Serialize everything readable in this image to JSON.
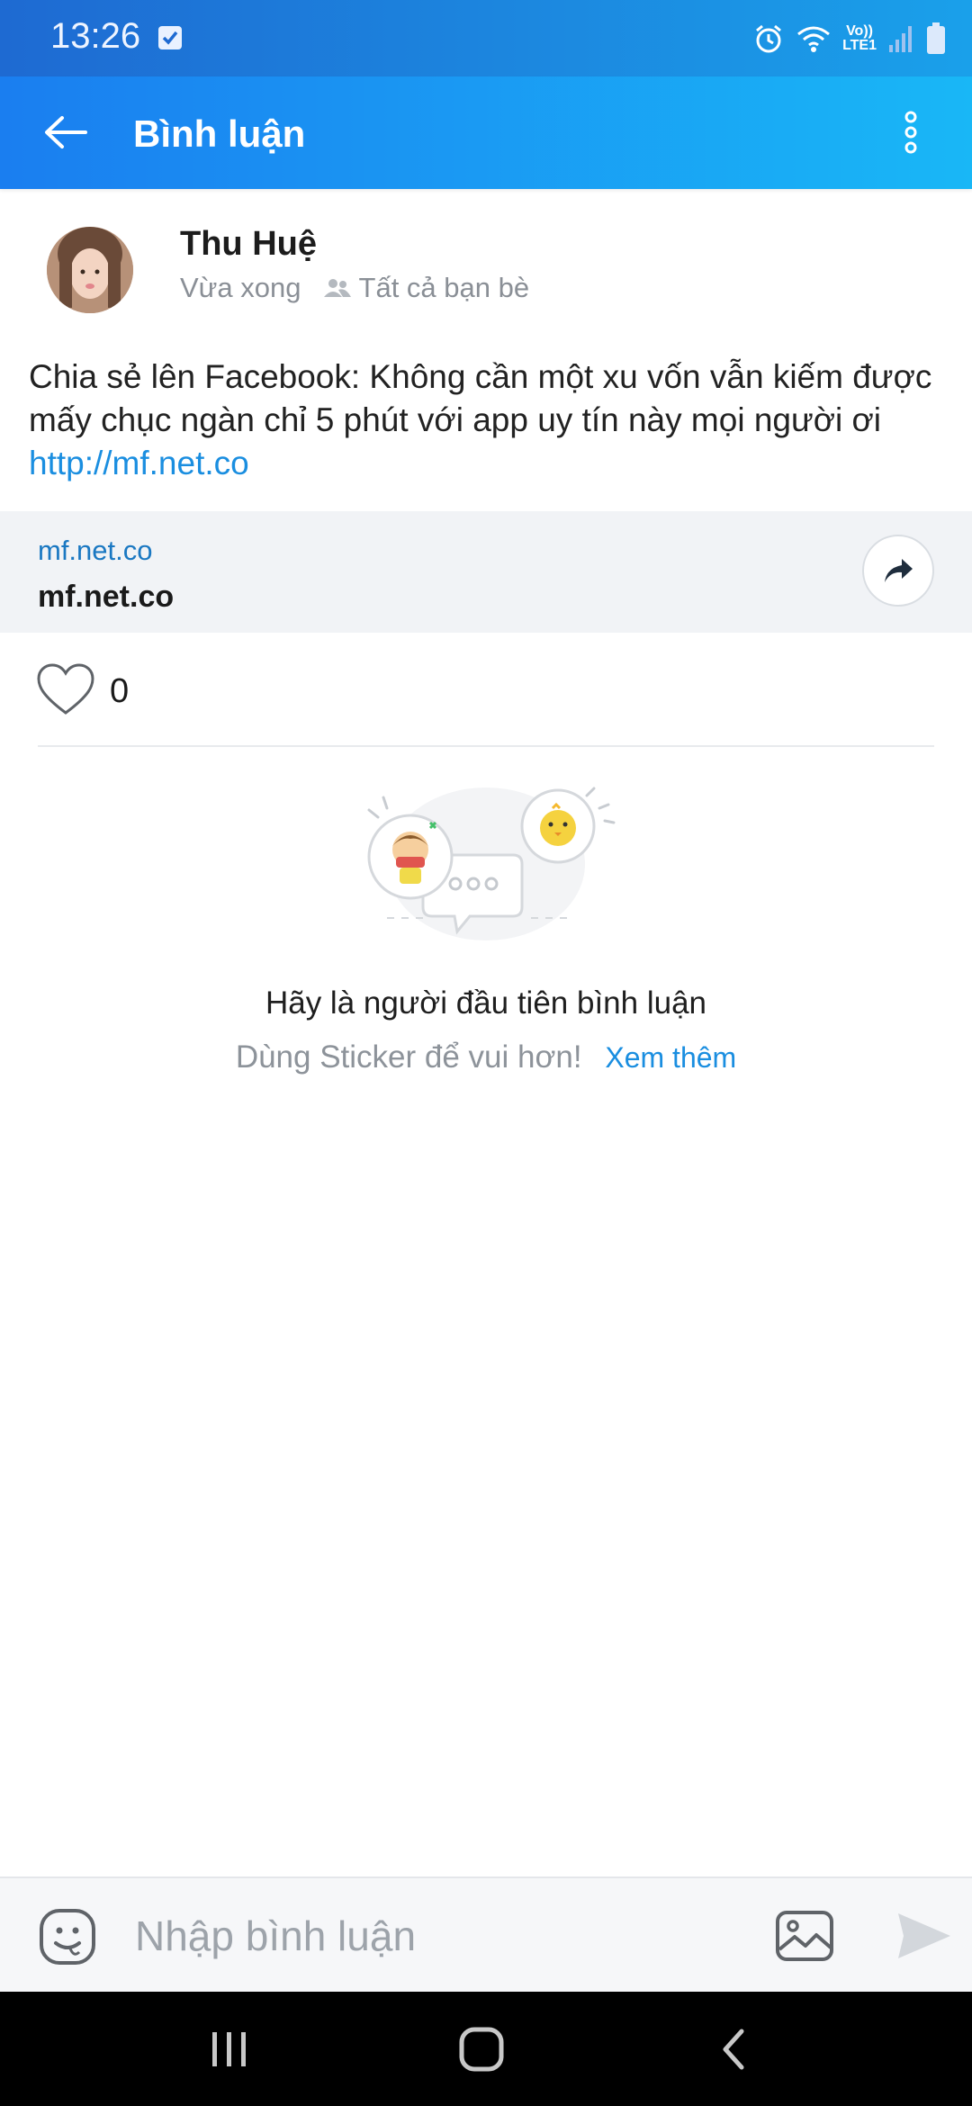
{
  "status_bar": {
    "time": "13:26",
    "network_label_top": "Vo))",
    "network_label_bottom": "LTE1"
  },
  "app_bar": {
    "title": "Bình luận"
  },
  "post": {
    "author_name": "Thu Huệ",
    "time_ago": "Vừa xong",
    "audience": "Tất cả bạn bè",
    "text": "Chia sẻ lên Facebook: Không cần một xu vốn vẫn kiếm được mấy chục ngàn chỉ 5 phút với app uy tín này mọi người ơi ",
    "link_text": "http://mf.net.co"
  },
  "link_preview": {
    "domain": "mf.net.co",
    "title": "mf.net.co"
  },
  "likes": {
    "count": "0"
  },
  "empty_state": {
    "title": "Hãy là người đầu tiên bình luận",
    "subtitle": "Dùng Sticker để vui hơn!",
    "see_more": "Xem thêm"
  },
  "comment_input": {
    "placeholder": "Nhập bình luận"
  },
  "colors": {
    "accent": "#1a8ee0",
    "header_start": "#1a7ef0",
    "header_end": "#19b7f6"
  }
}
